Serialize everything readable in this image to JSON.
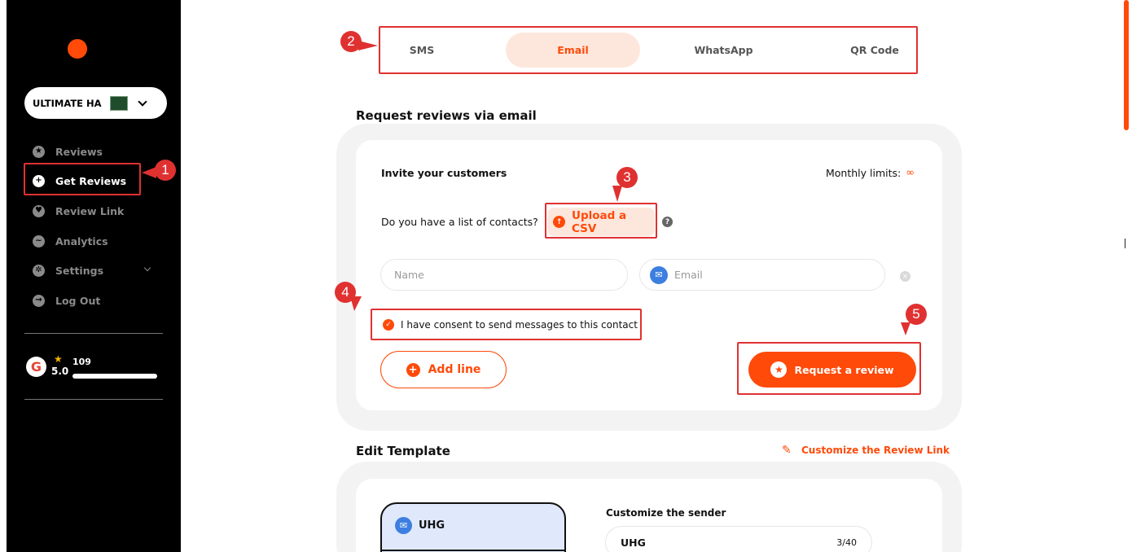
{
  "sidebar": {
    "business_name": "ULTIMATE HA",
    "items": [
      {
        "label": "Reviews"
      },
      {
        "label": "Get Reviews"
      },
      {
        "label": "Review Link"
      },
      {
        "label": "Analytics"
      },
      {
        "label": "Settings"
      },
      {
        "label": "Log Out"
      }
    ],
    "rating": "5.0",
    "review_count": "109"
  },
  "annotations": [
    "1",
    "2",
    "3",
    "4",
    "5"
  ],
  "tabs": [
    {
      "label": "SMS"
    },
    {
      "label": "Email"
    },
    {
      "label": "WhatsApp"
    },
    {
      "label": "QR Code"
    }
  ],
  "request": {
    "title": "Request reviews via email",
    "invite_label": "Invite your customers",
    "monthly_limits_label": "Monthly limits:",
    "monthly_limits_value": "∞",
    "contacts_question": "Do you have a list of contacts?",
    "upload_label": "Upload a CSV",
    "name_placeholder": "Name",
    "email_placeholder": "Email",
    "consent_label": "I have consent to send messages to this contact",
    "add_line_label": "Add line",
    "request_button_label": "Request a review"
  },
  "template": {
    "title": "Edit Template",
    "customize_link_label": "Customize the Review Link",
    "preview_sender": "UHG",
    "customize_sender_label": "Customize the sender",
    "sender_value": "UHG",
    "sender_count": "3/40"
  },
  "colors": {
    "accent": "#ff4a0a",
    "annotation": "#e03131",
    "sidebar_bg": "#000000"
  }
}
